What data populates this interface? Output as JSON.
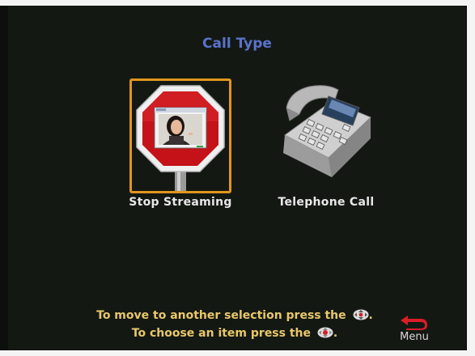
{
  "header": {
    "title": "Call Type"
  },
  "options": [
    {
      "label": "Stop Streaming",
      "selected": true,
      "icon": "stop-sign-icon"
    },
    {
      "label": "Telephone  Call",
      "selected": false,
      "icon": "telephone-icon"
    }
  ],
  "instructions": {
    "line1": "To move to another selection press the",
    "line2": "To choose an item press the"
  },
  "menu": {
    "label": "Menu",
    "icon": "back-arrow-icon"
  },
  "colors": {
    "title": "#5a73c9",
    "selection_border": "#e0961c",
    "instruction_text": "#e8c86a",
    "stop_sign_red": "#c41218"
  }
}
